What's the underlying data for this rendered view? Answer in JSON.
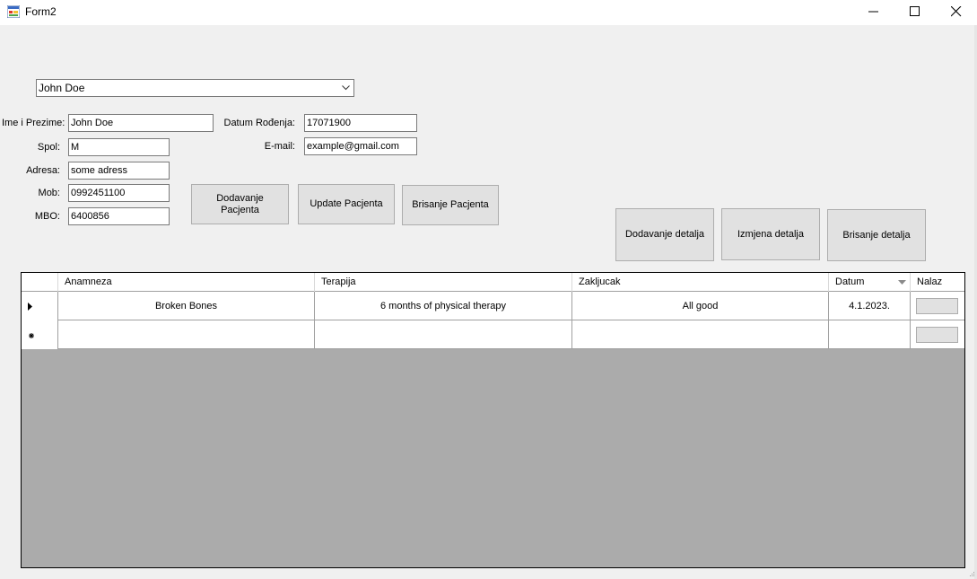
{
  "window": {
    "title": "Form2"
  },
  "patient_select": {
    "selected": "John Doe"
  },
  "form": {
    "name_label": "Ime i Prezime:",
    "name_value": "John Doe",
    "gender_label": "Spol:",
    "gender_value": "M",
    "address_label": "Adresa:",
    "address_value": "some adress",
    "mobile_label": "Mob:",
    "mobile_value": "0992451100",
    "mbo_label": "MBO:",
    "mbo_value": "6400856",
    "dob_label": "Datum Rođenja:",
    "dob_value": "17071900",
    "email_label": "E-mail:",
    "email_value": "example@gmail.com"
  },
  "patient_buttons": {
    "add": "Dodavanje Pacjenta",
    "update": "Update Pacjenta",
    "delete": "Brisanje Pacjenta"
  },
  "detail_buttons": {
    "add": "Dodavanje detalja",
    "edit": "Izmjena detalja",
    "delete": "Brisanje detalja"
  },
  "grid": {
    "columns": [
      "Anamneza",
      "Terapija",
      "Zakljucak",
      "Datum",
      "Nalaz"
    ],
    "rows": [
      {
        "anamneza": "Broken Bones",
        "terapija": "6 months of physical therapy",
        "zakljucak": "All good",
        "datum": "4.1.2023."
      }
    ]
  },
  "colors": {
    "grid_background": "#ababab",
    "button_face": "#e1e1e1",
    "window_bg": "#f0f0f0"
  }
}
